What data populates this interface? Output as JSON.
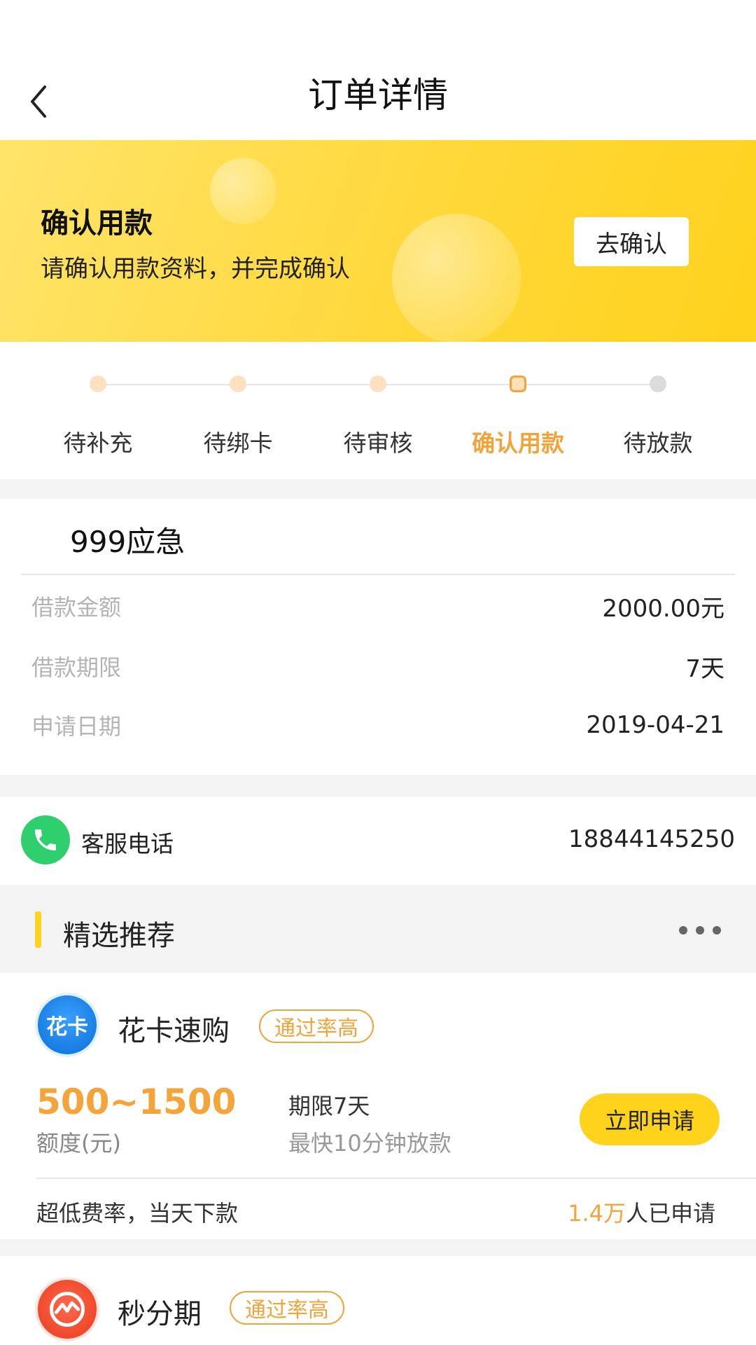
{
  "header": {
    "title": "订单详情"
  },
  "banner": {
    "title": "确认用款",
    "subtitle": "请确认用款资料，并完成确认",
    "button_label": "去确认"
  },
  "steps": [
    {
      "label": "待补充",
      "state": "done"
    },
    {
      "label": "待绑卡",
      "state": "done"
    },
    {
      "label": "待审核",
      "state": "done"
    },
    {
      "label": "确认用款",
      "state": "current"
    },
    {
      "label": "待放款",
      "state": "pending"
    }
  ],
  "loan": {
    "product_name": "999应急",
    "rows": [
      {
        "label": "借款金额",
        "value": "2000.00元"
      },
      {
        "label": "借款期限",
        "value": "7天"
      },
      {
        "label": "申请日期",
        "value": "2019-04-21"
      }
    ]
  },
  "service": {
    "label": "客服电话",
    "phone": "18844145250"
  },
  "recommend": {
    "title": "精选推荐",
    "products": [
      {
        "name": "花卡速购",
        "logo_text": "花卡",
        "tag": "通过率高",
        "amount": "500~1500",
        "amount_label": "额度(元)",
        "term": "期限7天",
        "speed": "最快10分钟放款",
        "apply_label": "立即申请",
        "note": "超低费率，当天下款",
        "applied_count": "1.4万",
        "applied_suffix": "人已申请"
      },
      {
        "name": "秒分期",
        "tag": "通过率高"
      }
    ]
  },
  "colors": {
    "accent": "#f0a43a",
    "yellow": "#ffd21c",
    "phone_green": "#2fcf6e"
  },
  "icons": {
    "back": "chevron-left-icon",
    "phone": "phone-icon",
    "more": "more-dots-icon"
  }
}
